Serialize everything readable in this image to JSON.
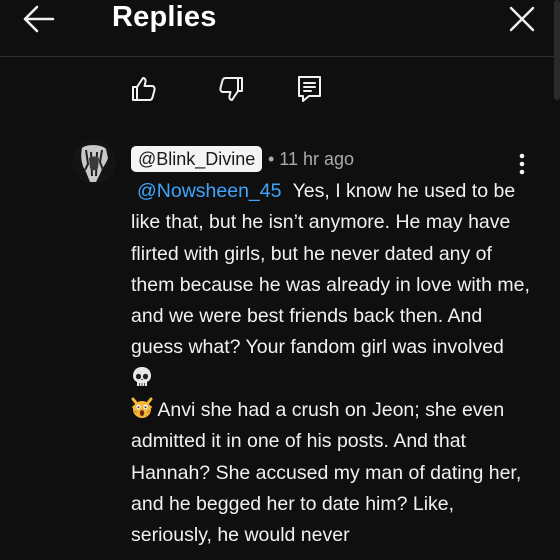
{
  "header": {
    "title": "Replies",
    "back_icon": "arrow-left-icon",
    "close_icon": "close-icon"
  },
  "actions": {
    "like_icon": "thumbs-up-icon",
    "dislike_icon": "thumbs-down-icon",
    "reply_icon": "comment-icon"
  },
  "comment": {
    "author": "@Blink_Divine",
    "time": "• 11 hr ago",
    "mention": "@Nowsheen_45",
    "text_1": "Yes, I know he used to be like that, but he isn’t anymore. He may have flirted with girls, but he never dated any of them because he was already in love with me, and we were best friends back then. And guess what? Your fandom girl was involved",
    "emoji_1": "skull-emoji",
    "emoji_2": "screaming-cat-emoji",
    "text_2": "Anvi she had a crush on Jeon; she even admitted it in one of his posts. And that Hannah? She accused my man of dating her, and he begged her to date him? Like, seriously, he would never"
  },
  "colors": {
    "background": "#0f0f0f",
    "text": "#f1f1f1",
    "mention": "#3ea6ff",
    "meta": "#aaaaaa",
    "handle_bg": "#f4f4f4"
  }
}
